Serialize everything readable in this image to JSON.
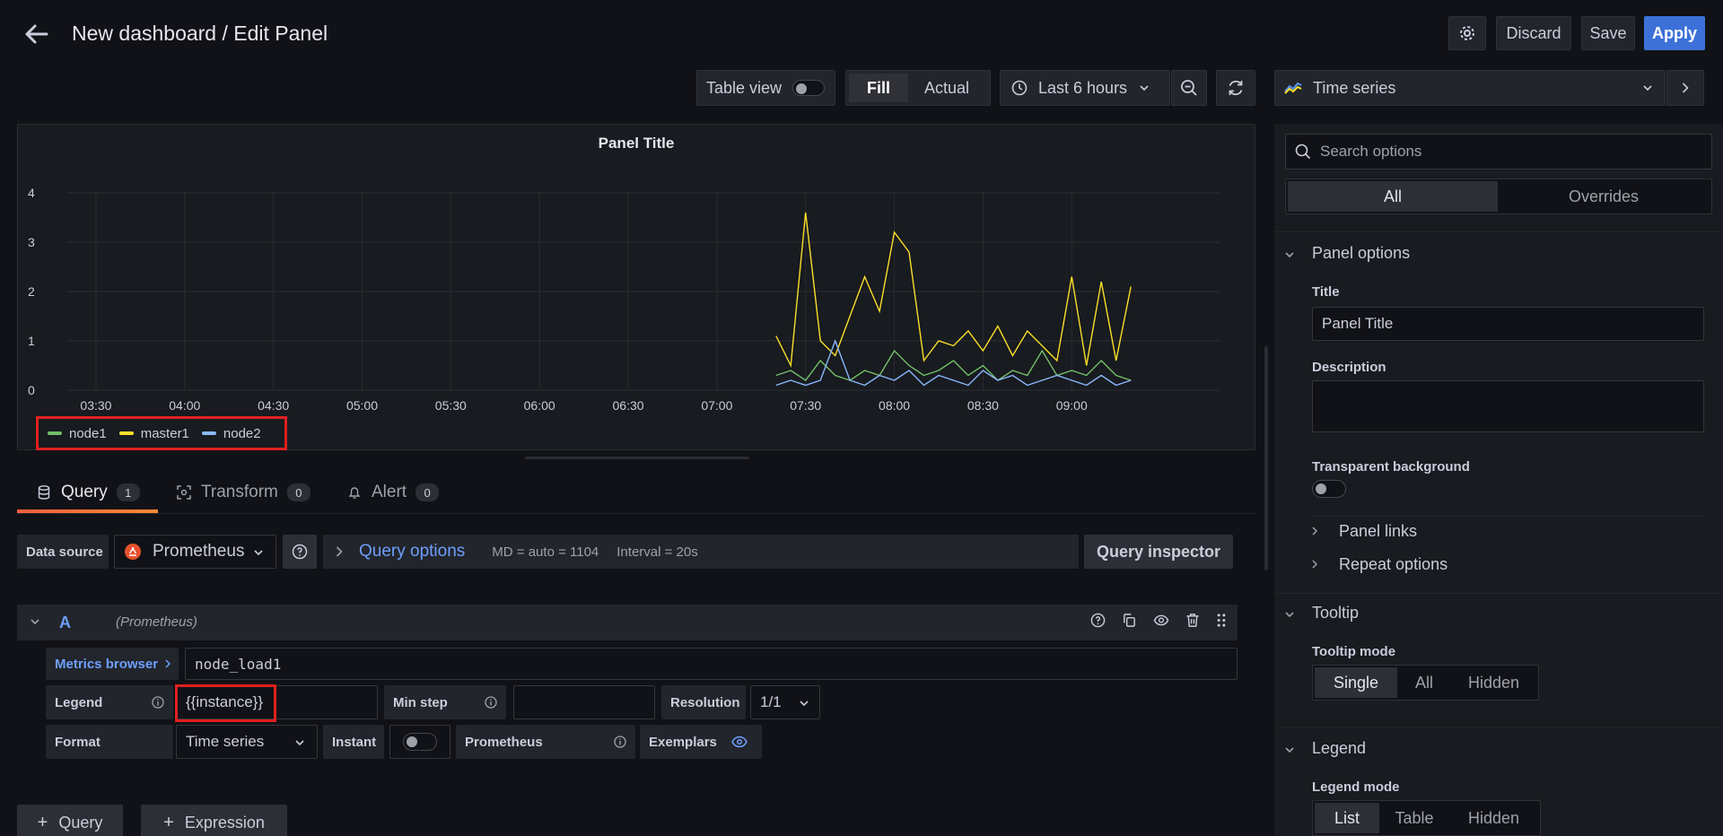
{
  "header": {
    "title": "New dashboard / Edit Panel",
    "discard": "Discard",
    "save": "Save",
    "apply": "Apply"
  },
  "toolbar": {
    "table_view": "Table view",
    "fill": "Fill",
    "actual": "Actual",
    "time_range": "Last 6 hours",
    "visualization": "Time series"
  },
  "panel": {
    "title": "Panel Title",
    "legend": [
      {
        "name": "node1",
        "color": "#73bf69"
      },
      {
        "name": "master1",
        "color": "#fade2a"
      },
      {
        "name": "node2",
        "color": "#8ab8ff"
      }
    ]
  },
  "chart_data": {
    "type": "line",
    "title": "Panel Title",
    "ylim": [
      0,
      4
    ],
    "y_ticks": [
      "0",
      "1",
      "2",
      "3",
      "4"
    ],
    "x_ticks": [
      "03:30",
      "04:00",
      "04:30",
      "05:00",
      "05:30",
      "06:00",
      "06:30",
      "07:00",
      "07:30",
      "08:00",
      "08:30",
      "09:00"
    ],
    "grid": true,
    "legend": "bottom-left",
    "series": [
      {
        "name": "node1",
        "color": "#73bf69",
        "x": [
          "07:20",
          "07:25",
          "07:30",
          "07:35",
          "07:40",
          "07:45",
          "07:50",
          "07:55",
          "08:00",
          "08:05",
          "08:10",
          "08:15",
          "08:20",
          "08:25",
          "08:30",
          "08:35",
          "08:40",
          "08:45",
          "08:50",
          "08:55",
          "09:00",
          "09:05",
          "09:10",
          "09:15",
          "09:20"
        ],
        "values": [
          0.3,
          0.4,
          0.2,
          0.6,
          0.3,
          0.2,
          0.4,
          0.3,
          0.8,
          0.5,
          0.3,
          0.4,
          0.6,
          0.3,
          0.5,
          0.2,
          0.4,
          0.3,
          0.8,
          0.3,
          0.4,
          0.3,
          0.6,
          0.3,
          0.2
        ]
      },
      {
        "name": "master1",
        "color": "#fade2a",
        "x": [
          "07:20",
          "07:25",
          "07:30",
          "07:35",
          "07:40",
          "07:45",
          "07:50",
          "07:55",
          "08:00",
          "08:05",
          "08:10",
          "08:15",
          "08:20",
          "08:25",
          "08:30",
          "08:35",
          "08:40",
          "08:45",
          "08:50",
          "08:55",
          "09:00",
          "09:05",
          "09:10",
          "09:15",
          "09:20"
        ],
        "values": [
          1.1,
          0.5,
          3.6,
          1.0,
          0.7,
          1.5,
          2.3,
          1.6,
          3.2,
          2.8,
          0.6,
          1.0,
          0.9,
          1.2,
          0.8,
          1.3,
          0.7,
          1.2,
          0.9,
          0.6,
          2.3,
          0.5,
          2.2,
          0.6,
          2.1
        ]
      },
      {
        "name": "node2",
        "color": "#8ab8ff",
        "x": [
          "07:20",
          "07:25",
          "07:30",
          "07:35",
          "07:40",
          "07:45",
          "07:50",
          "07:55",
          "08:00",
          "08:05",
          "08:10",
          "08:15",
          "08:20",
          "08:25",
          "08:30",
          "08:35",
          "08:40",
          "08:45",
          "08:50",
          "08:55",
          "09:00",
          "09:05",
          "09:10",
          "09:15",
          "09:20"
        ],
        "values": [
          0.1,
          0.2,
          0.1,
          0.2,
          1.0,
          0.2,
          0.1,
          0.3,
          0.2,
          0.4,
          0.1,
          0.3,
          0.2,
          0.1,
          0.4,
          0.2,
          0.3,
          0.1,
          0.2,
          0.3,
          0.2,
          0.1,
          0.3,
          0.1,
          0.2
        ]
      }
    ]
  },
  "query_tabs": [
    {
      "label": "Query",
      "count": "1"
    },
    {
      "label": "Transform",
      "count": "0"
    },
    {
      "label": "Alert",
      "count": "0"
    }
  ],
  "query_bar": {
    "data_source_label": "Data source",
    "data_source": "Prometheus",
    "query_options": "Query options",
    "md": "MD = auto = 1104",
    "interval": "Interval = 20s",
    "inspector": "Query inspector"
  },
  "query_row": {
    "letter": "A",
    "source": "(Prometheus)",
    "metrics_browser": "Metrics browser",
    "metric": "node_load1",
    "legend_label": "Legend",
    "legend_value": "{{instance}}",
    "min_step_label": "Min step",
    "resolution_label": "Resolution",
    "resolution_value": "1/1",
    "format_label": "Format",
    "format_value": "Time series",
    "instant_label": "Instant",
    "prometheus_label": "Prometheus",
    "exemplars_label": "Exemplars"
  },
  "add": {
    "query": "Query",
    "expression": "Expression"
  },
  "options": {
    "search_placeholder": "Search options",
    "tab_all": "All",
    "tab_overrides": "Overrides",
    "panel_options": "Panel options",
    "title_label": "Title",
    "title_value": "Panel Title",
    "description_label": "Description",
    "transparent_label": "Transparent background",
    "panel_links": "Panel links",
    "repeat_options": "Repeat options",
    "tooltip": "Tooltip",
    "tooltip_mode_label": "Tooltip mode",
    "tooltip_modes": [
      "Single",
      "All",
      "Hidden"
    ],
    "legend": "Legend",
    "legend_mode_label": "Legend mode",
    "legend_modes": [
      "List",
      "Table",
      "Hidden"
    ]
  }
}
